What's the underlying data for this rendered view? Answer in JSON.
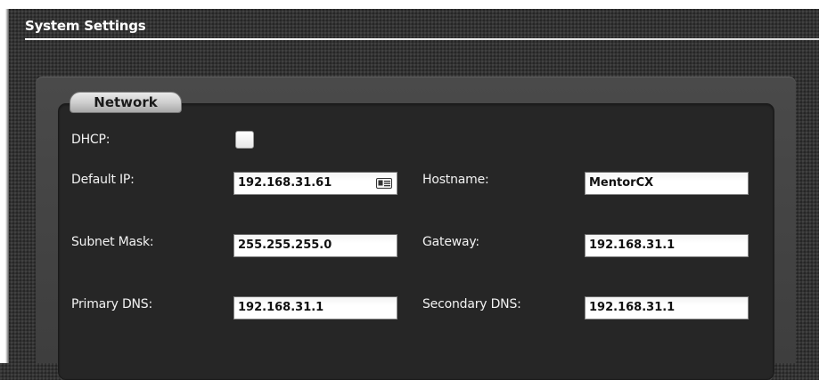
{
  "page": {
    "section_title": "System Settings"
  },
  "network": {
    "legend": "Network",
    "dhcp": {
      "label": "DHCP:",
      "checked": false
    },
    "default_ip": {
      "label": "Default IP:",
      "value": "192.168.31.61",
      "icon": "contact-card-icon"
    },
    "hostname": {
      "label": "Hostname:",
      "value": "MentorCX"
    },
    "subnet_mask": {
      "label": "Subnet Mask:",
      "value": "255.255.255.0"
    },
    "gateway": {
      "label": "Gateway:",
      "value": "192.168.31.1"
    },
    "primary_dns": {
      "label": "Primary DNS:",
      "value": "192.168.31.1"
    },
    "secondary_dns": {
      "label": "Secondary DNS:",
      "value": "192.168.31.1"
    }
  },
  "colors": {
    "background": "#333333",
    "panel": "#3e3e3e",
    "fieldset": "#262626",
    "text": "#f2f2f2"
  }
}
